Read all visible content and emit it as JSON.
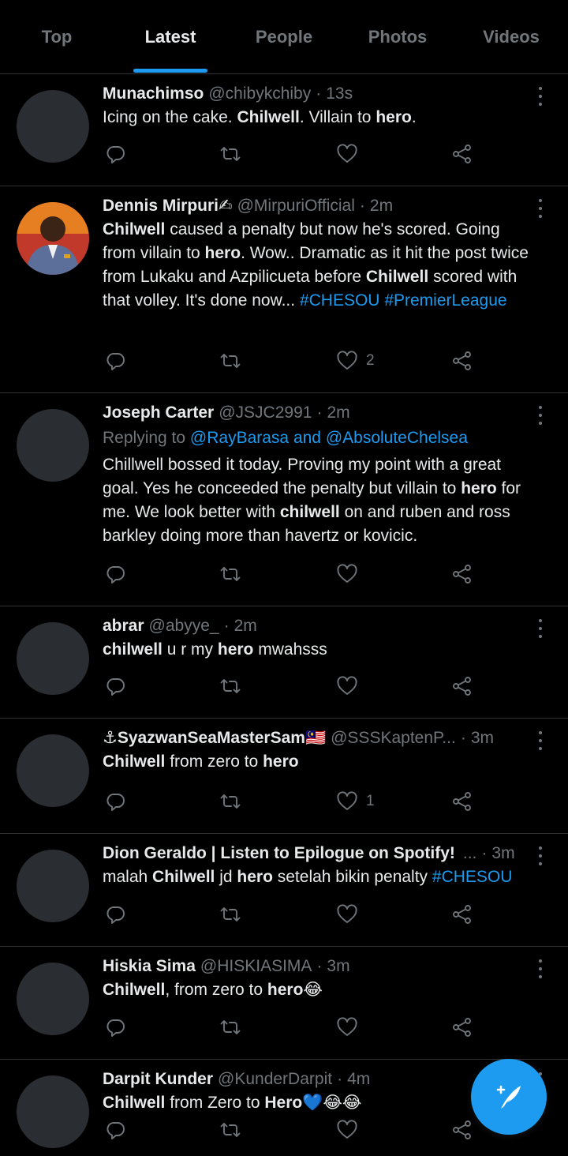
{
  "tabs": [
    {
      "label": "Top"
    },
    {
      "label": "Latest"
    },
    {
      "label": "People"
    },
    {
      "label": "Photos"
    },
    {
      "label": "Videos"
    }
  ],
  "colors": {
    "accent": "#1d9bf0",
    "muted": "#71767b",
    "text": "#e7e9ea",
    "divider": "#2f3336"
  },
  "tweets": [
    {
      "name": "Munachimso",
      "handle": "@chibykchiby",
      "time": "13s",
      "text": [
        [
          "Icing on the cake. ",
          "t"
        ],
        [
          "Chilwell",
          "b"
        ],
        [
          ". Villain to ",
          "t"
        ],
        [
          "hero",
          "b"
        ],
        [
          ".",
          "t"
        ]
      ],
      "likes": ""
    },
    {
      "name": "Dennis Mirpuri✍",
      "handle": "@MirpuriOfficial",
      "time": "2m",
      "text": [
        [
          "Chilwell",
          "b"
        ],
        [
          " caused a penalty but now he's scored. Going from villain to ",
          "t"
        ],
        [
          "hero",
          "b"
        ],
        [
          ". Wow.. Dramatic as it hit the post twice from Lukaku and Azpilicueta before ",
          "t"
        ],
        [
          "Chilwell",
          "b"
        ],
        [
          " scored with that volley. It's done now... ",
          "t"
        ],
        [
          "#CHESOU",
          "h"
        ],
        [
          " ",
          "t"
        ],
        [
          "#PremierLeague",
          "h"
        ]
      ],
      "likes": "2"
    },
    {
      "name": "Joseph Carter",
      "handle": "@JSJC2991",
      "time": "2m",
      "reply_prefix": "Replying to ",
      "reply_to": "@RayBarasa and @AbsoluteChelsea",
      "text": [
        [
          "Chillwell bossed it today. Proving my point with a great goal. Yes he conceeded the penalty but villain to ",
          "t"
        ],
        [
          "hero",
          "b"
        ],
        [
          " for me. We look better with ",
          "t"
        ],
        [
          "chilwell",
          "b"
        ],
        [
          " on and ruben and ross barkley doing more than havertz or kovicic.",
          "t"
        ]
      ],
      "likes": ""
    },
    {
      "name": "abrar",
      "handle": "@abyye_",
      "time": "2m",
      "text": [
        [
          "chilwell",
          "b"
        ],
        [
          " u r my ",
          "t"
        ],
        [
          "hero",
          "b"
        ],
        [
          " mwahsss",
          "t"
        ]
      ],
      "likes": ""
    },
    {
      "name": "⚓SyazwanSeaMasterSam🇲🇾",
      "handle": "@SSSKaptenP...",
      "time": "3m",
      "text": [
        [
          "Chilwell",
          "b"
        ],
        [
          " from zero to ",
          "t"
        ],
        [
          "hero",
          "b"
        ]
      ],
      "likes": "1"
    },
    {
      "name": "Dion Geraldo | Listen to Epilogue on Spotify!",
      "handle": "...",
      "time": "3m",
      "text": [
        [
          "malah ",
          "t"
        ],
        [
          "Chilwell",
          "b"
        ],
        [
          " jd ",
          "t"
        ],
        [
          "hero",
          "b"
        ],
        [
          " setelah bikin penalty ",
          "t"
        ],
        [
          "#CHESOU",
          "h"
        ]
      ],
      "likes": ""
    },
    {
      "name": "Hiskia Sima",
      "handle": "@HISKIASIMA",
      "time": "3m",
      "text": [
        [
          "Chilwell",
          "b"
        ],
        [
          ", from zero to ",
          "t"
        ],
        [
          "hero",
          "b"
        ],
        [
          "😂",
          "t"
        ]
      ],
      "likes": ""
    },
    {
      "name": "Darpit Kunder",
      "handle": "@KunderDarpit",
      "time": "4m",
      "text": [
        [
          "Chilwell",
          "b"
        ],
        [
          " from Zero to ",
          "t"
        ],
        [
          "Hero",
          "b"
        ],
        [
          "💙😂😂",
          "t"
        ]
      ],
      "likes": ""
    }
  ],
  "icons": {
    "reply": "reply-icon",
    "retweet": "retweet-icon",
    "like": "heart-icon",
    "share": "share-icon",
    "more": "more-vertical-icon",
    "compose": "compose-tweet-icon"
  }
}
